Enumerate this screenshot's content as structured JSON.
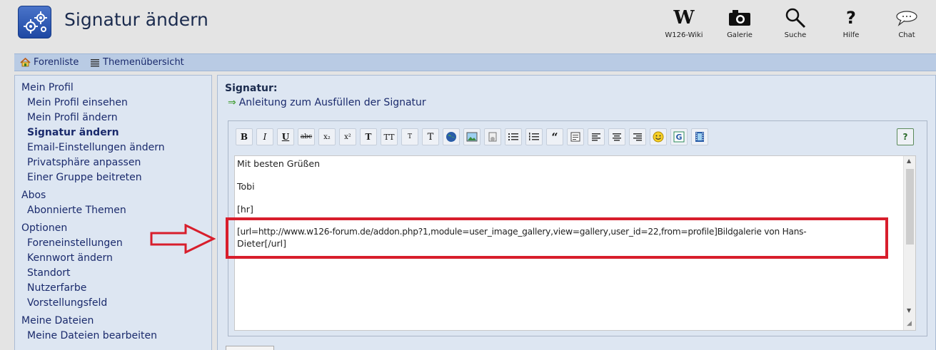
{
  "header": {
    "title": "Signatur ändern",
    "nav": [
      {
        "label": "W126-Wiki",
        "icon": "wiki-w-icon"
      },
      {
        "label": "Galerie",
        "icon": "camera-icon"
      },
      {
        "label": "Suche",
        "icon": "search-icon"
      },
      {
        "label": "Hilfe",
        "icon": "help-icon"
      },
      {
        "label": "Chat",
        "icon": "chat-icon"
      }
    ]
  },
  "breadcrumb": {
    "forum_list": "Forenliste",
    "topics": "Themenübersicht"
  },
  "sidebar": {
    "sections": [
      {
        "title": "Mein Profil",
        "items": [
          "Mein Profil einsehen",
          "Mein Profil ändern",
          "Signatur ändern",
          "Email-Einstellungen ändern",
          "Privatsphäre anpassen",
          "Einer Gruppe beitreten"
        ]
      },
      {
        "title": "Abos",
        "items": [
          "Abonnierte Themen"
        ]
      },
      {
        "title": "Optionen",
        "items": [
          "Foreneinstellungen",
          "Kennwort ändern",
          "Standort",
          "Nutzerfarbe",
          "Vorstellungsfeld"
        ]
      },
      {
        "title": "Meine Dateien",
        "items": [
          "Meine Dateien bearbeiten"
        ]
      }
    ],
    "active_item": "Signatur ändern"
  },
  "main": {
    "label": "Signatur:",
    "guide_link": "Anleitung zum Ausfüllen der Signatur",
    "toolbar": {
      "bold": "B",
      "italic": "I",
      "underline": "U",
      "strike": "abc",
      "subscript": "x₂",
      "superscript": "x²",
      "font_color": "T",
      "font_size": "TT",
      "small": "T",
      "normal": "T",
      "help": "?"
    },
    "textarea_lines": [
      "Mit besten Grüßen",
      "Tobi",
      "[hr]",
      "[url=http://www.w126-forum.de/addon.php?1,module=user_image_gallery,view=gallery,user_id=22,from=profile]Bildgalerie von Hans-",
      "Dieter[/url]"
    ]
  },
  "colors": {
    "highlight": "#d81e2c",
    "panel_bg": "#dde6f2",
    "bar_bg": "#b9cbe4",
    "link": "#1a2a6c"
  }
}
